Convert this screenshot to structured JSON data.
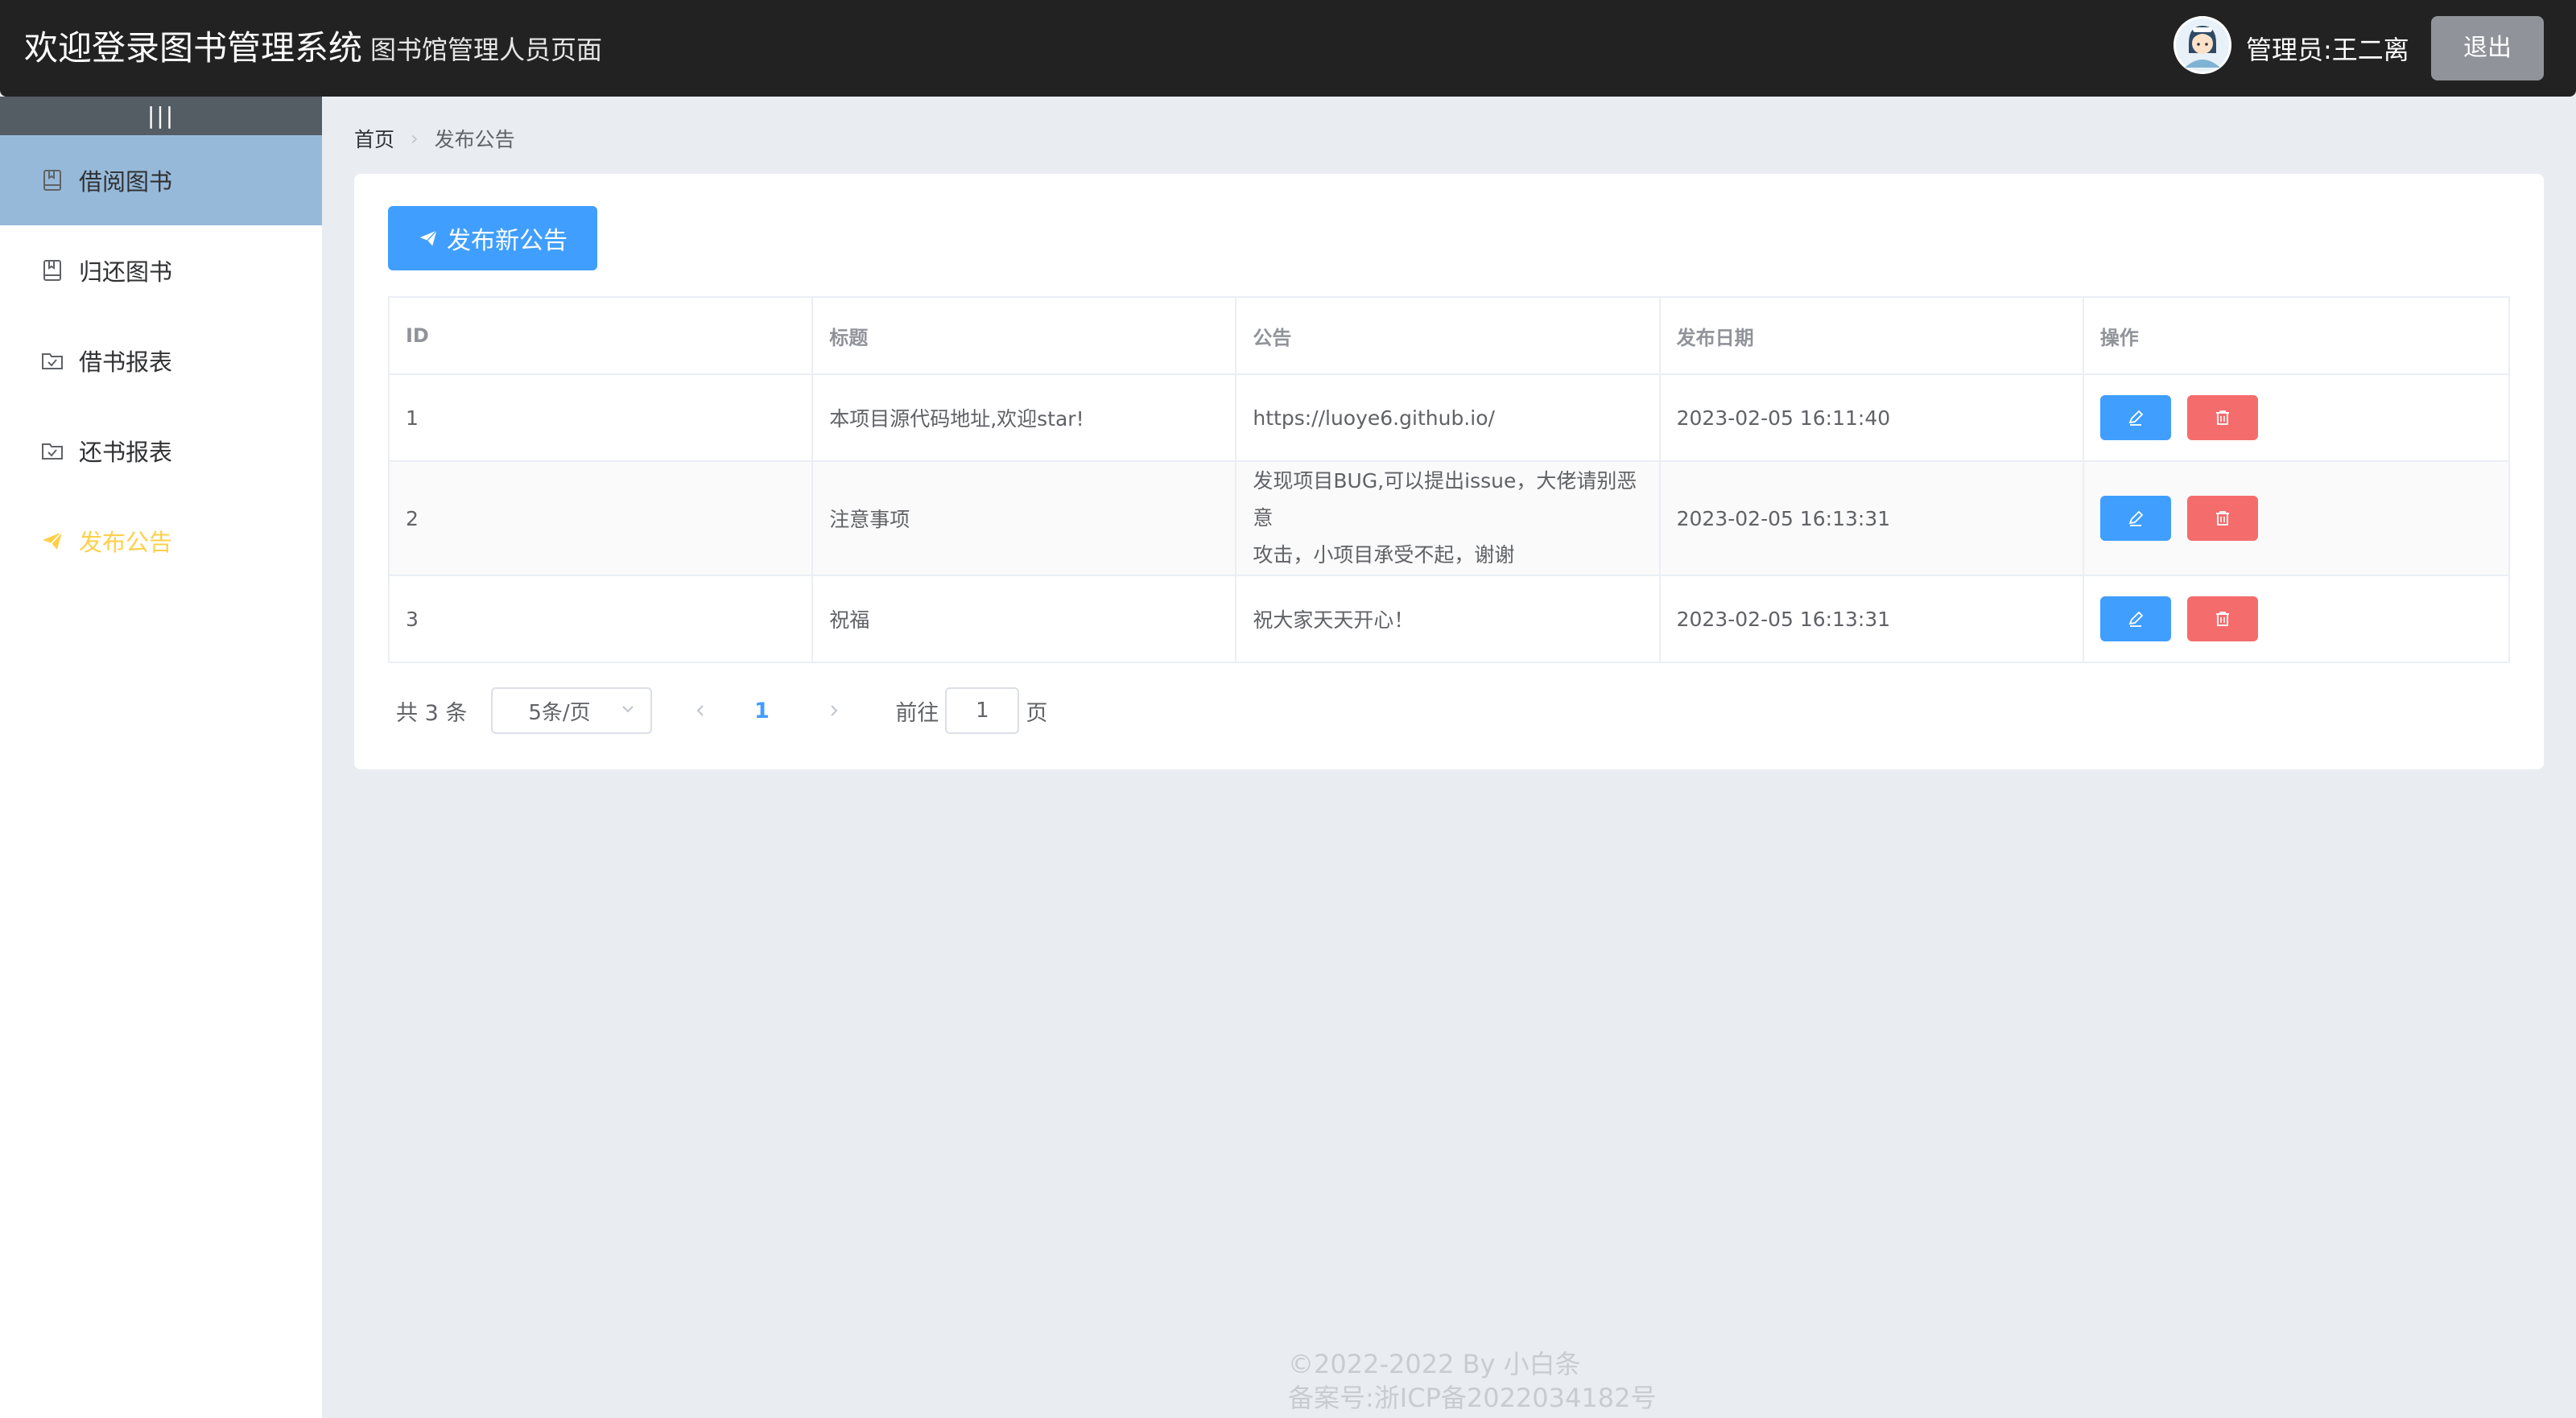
{
  "header": {
    "title": "欢迎登录图书管理系统",
    "subtitle": "图书馆管理人员页面",
    "admin_label": "管理员:王二离",
    "logout_label": "退出"
  },
  "sidebar": {
    "collapse_icon": "|||",
    "items": [
      {
        "label": "借阅图书",
        "icon": "book-icon",
        "active": true
      },
      {
        "label": "归还图书",
        "icon": "book-icon"
      },
      {
        "label": "借书报表",
        "icon": "folder-check-icon"
      },
      {
        "label": "还书报表",
        "icon": "folder-check-icon"
      },
      {
        "label": "发布公告",
        "icon": "send-icon",
        "highlight": true
      }
    ]
  },
  "breadcrumb": {
    "home": "首页",
    "current": "发布公告"
  },
  "main": {
    "publish_button": "发布新公告",
    "table": {
      "headers": [
        "ID",
        "标题",
        "公告",
        "发布日期",
        "操作"
      ],
      "rows": [
        {
          "id": "1",
          "title": "本项目源代码地址,欢迎star!",
          "notice": "https://luoye6.github.io/",
          "date": "2023-02-05 16:11:40"
        },
        {
          "id": "2",
          "title": "注意事项",
          "notice_line1": "发现项目BUG,可以提出issue，大佬请别恶意",
          "notice_line2": "攻击，小项目承受不起，谢谢",
          "date": "2023-02-05 16:13:31"
        },
        {
          "id": "3",
          "title": "祝福",
          "notice": "祝大家天天开心！",
          "date": "2023-02-05 16:13:31"
        }
      ]
    },
    "pagination": {
      "total": "共 3 条",
      "page_size": "5条/页",
      "current_page": "1",
      "goto_prefix": "前往",
      "goto_value": "1",
      "goto_suffix": "页"
    }
  },
  "footer": {
    "line1": "©2022-2022 By 小白条",
    "line2": "备案号:浙ICP备2022034182号"
  },
  "colors": {
    "header_bg": "#222222",
    "primary": "#409eff",
    "danger": "#f56c6c",
    "active_menu_bg": "#97b9d9",
    "highlight_text": "#ffd04b"
  }
}
